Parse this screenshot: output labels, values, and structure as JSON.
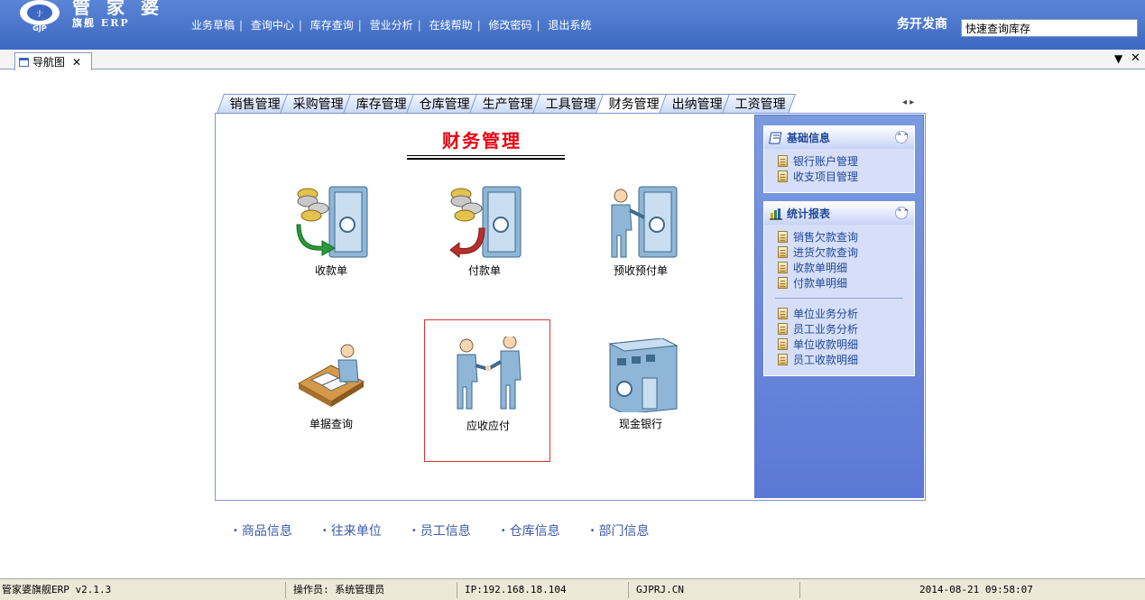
{
  "header": {
    "logo_text": "GJP",
    "brand_name": "管家婆",
    "brand_subtitle": "旗舰 ERP",
    "nav": [
      "业务草稿",
      "查询中心",
      "库存查询",
      "营业分析",
      "在线帮助",
      "修改密码",
      "退出系统"
    ],
    "company": "务开发商",
    "quick_search_value": "快速查询库存"
  },
  "tab": {
    "label": "导航图",
    "close": "✕"
  },
  "module_tabs": [
    "销售管理",
    "采购管理",
    "库存管理",
    "仓库管理",
    "生产管理",
    "工具管理",
    "财务管理",
    "出纳管理",
    "工资管理"
  ],
  "active_tab": "财务管理",
  "main": {
    "title": "财务管理",
    "functions": [
      {
        "label": "收款单",
        "icon": "receipt-safe-icon"
      },
      {
        "label": "付款单",
        "icon": "payment-safe-icon"
      },
      {
        "label": "预收预付单",
        "icon": "prepay-safe-icon"
      },
      {
        "label": "单据查询",
        "icon": "document-query-icon"
      },
      {
        "label": "应收应付",
        "icon": "handshake-icon"
      },
      {
        "label": "现金银行",
        "icon": "bank-building-icon"
      }
    ]
  },
  "sidebar": {
    "basic": {
      "title": "基础信息",
      "items": [
        "银行账户管理",
        "收支项目管理"
      ]
    },
    "reports": {
      "title": "统计报表",
      "items_a": [
        "销售欠款查询",
        "进货欠款查询",
        "收款单明细",
        "付款单明细"
      ],
      "items_b": [
        "单位业务分析",
        "员工业务分析",
        "单位收款明细",
        "员工收款明细"
      ]
    }
  },
  "info_links": [
    "商品信息",
    "往来单位",
    "员工信息",
    "仓库信息",
    "部门信息"
  ],
  "status": {
    "version": "管家婆旗舰ERP v2.1.3",
    "operator": "操作员: 系统管理员",
    "ip": "IP:192.168.18.104",
    "site": "GJPRJ.CN",
    "datetime": "2014-08-21 09:58:07"
  },
  "colors": {
    "header_blue": "#4a75cc",
    "title_red": "#e8000f",
    "sidebar_blue": "#6a88dc",
    "link_blue": "#21479a"
  }
}
